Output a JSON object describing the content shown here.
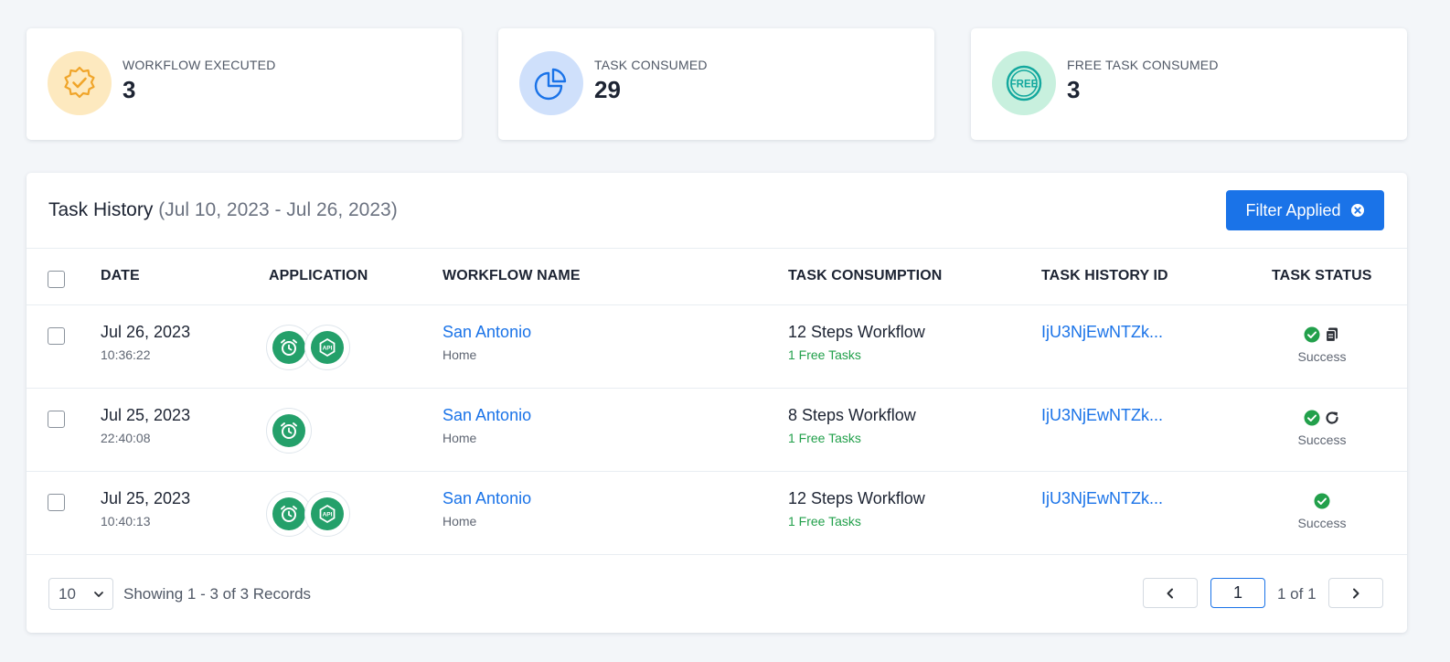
{
  "stats": [
    {
      "label": "WORKFLOW EXECUTED",
      "value": "3",
      "icon": "badge-check-icon",
      "bg": "#fde9bf",
      "color": "#f0a52a"
    },
    {
      "label": "TASK CONSUMED",
      "value": "29",
      "icon": "pie-chart-icon",
      "bg": "#cfe0fb",
      "color": "#1a73e8"
    },
    {
      "label": "FREE TASK CONSUMED",
      "value": "3",
      "icon": "free-stamp-icon",
      "bg": "#c8f0de",
      "color": "#13a89e"
    }
  ],
  "panel": {
    "title": "Task History",
    "range": "(Jul 10, 2023 - Jul 26, 2023)",
    "filter_label": "Filter Applied"
  },
  "columns": {
    "date": "DATE",
    "application": "APPLICATION",
    "workflow": "WORKFLOW NAME",
    "consumption": "TASK CONSUMPTION",
    "history_id": "TASK HISTORY ID",
    "status": "TASK STATUS"
  },
  "rows": [
    {
      "date": "Jul 26, 2023",
      "time": "10:36:22",
      "apps": [
        "alarm-clock-icon",
        "api-icon"
      ],
      "workflow": "San Antonio",
      "folder": "Home",
      "steps": "12 Steps Workflow",
      "free": "1 Free Tasks",
      "id": "IjU3NjEwNTZk...",
      "status": "Success",
      "extra_icon": "copy-icon"
    },
    {
      "date": "Jul 25, 2023",
      "time": "22:40:08",
      "apps": [
        "alarm-clock-icon"
      ],
      "workflow": "San Antonio",
      "folder": "Home",
      "steps": "8 Steps Workflow",
      "free": "1 Free Tasks",
      "id": "IjU3NjEwNTZk...",
      "status": "Success",
      "extra_icon": "retry-icon"
    },
    {
      "date": "Jul 25, 2023",
      "time": "10:40:13",
      "apps": [
        "alarm-clock-icon",
        "api-icon"
      ],
      "workflow": "San Antonio",
      "folder": "Home",
      "steps": "12 Steps Workflow",
      "free": "1 Free Tasks",
      "id": "IjU3NjEwNTZk...",
      "status": "Success",
      "extra_icon": ""
    }
  ],
  "footer": {
    "page_size": "10",
    "showing": "Showing 1 - 3 of 3 Records",
    "page": "1",
    "page_of": "1 of 1"
  },
  "colors": {
    "accent": "#1a73e8",
    "success": "#22a04b",
    "app_green": "#24a06a"
  }
}
